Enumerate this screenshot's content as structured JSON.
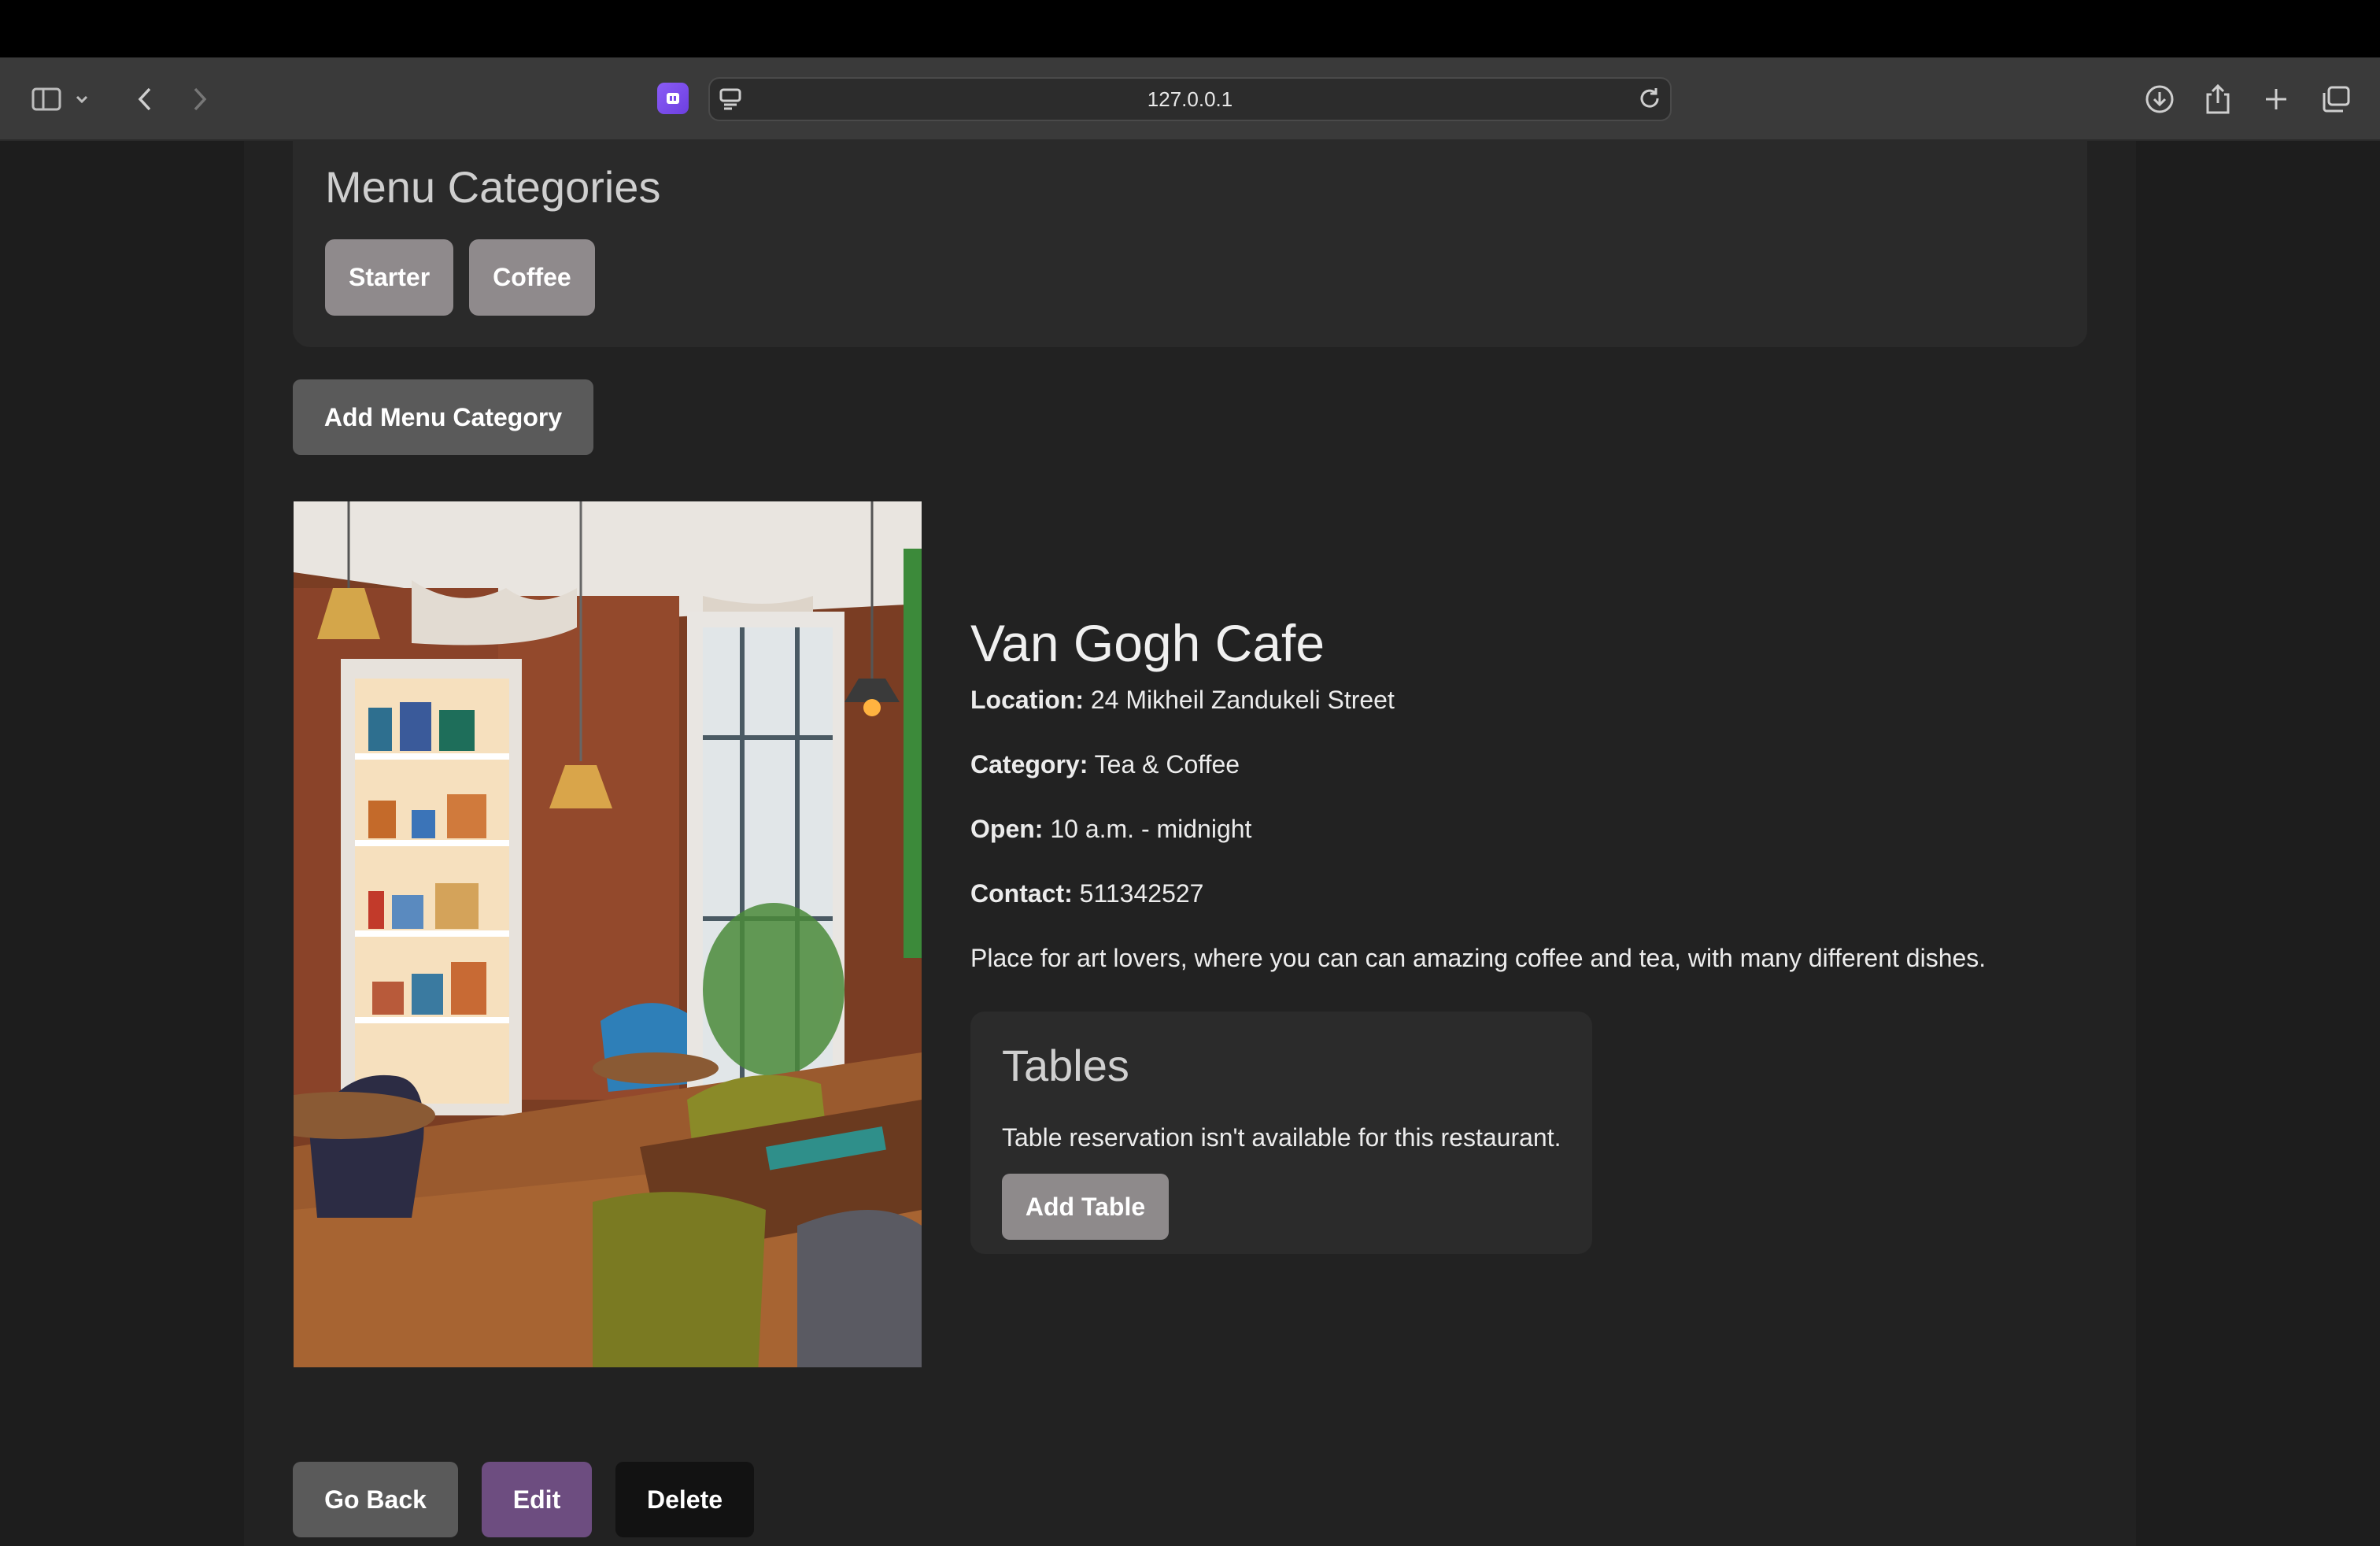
{
  "browser": {
    "url": "127.0.0.1"
  },
  "menu_categories": {
    "title": "Menu Categories",
    "items": [
      "Starter",
      "Coffee"
    ]
  },
  "add_menu_category_label": "Add Menu Category",
  "restaurant": {
    "name": "Van Gogh Cafe",
    "location_label": "Location:",
    "location": "24 Mikheil Zandukeli Street",
    "category_label": "Category:",
    "category": "Tea & Coffee",
    "open_label": "Open:",
    "open": "10 a.m. - midnight",
    "contact_label": "Contact:",
    "contact": "511342527",
    "description": "Place for art lovers, where you can can amazing coffee and tea, with many different dishes."
  },
  "tables": {
    "title": "Tables",
    "message": "Table reservation isn't available for this restaurant.",
    "add_label": "Add Table"
  },
  "actions": {
    "back": "Go Back",
    "edit": "Edit",
    "delete": "Delete"
  },
  "colors": {
    "accent_edit": "#6d4d80",
    "chip": "#8f8a8c"
  }
}
